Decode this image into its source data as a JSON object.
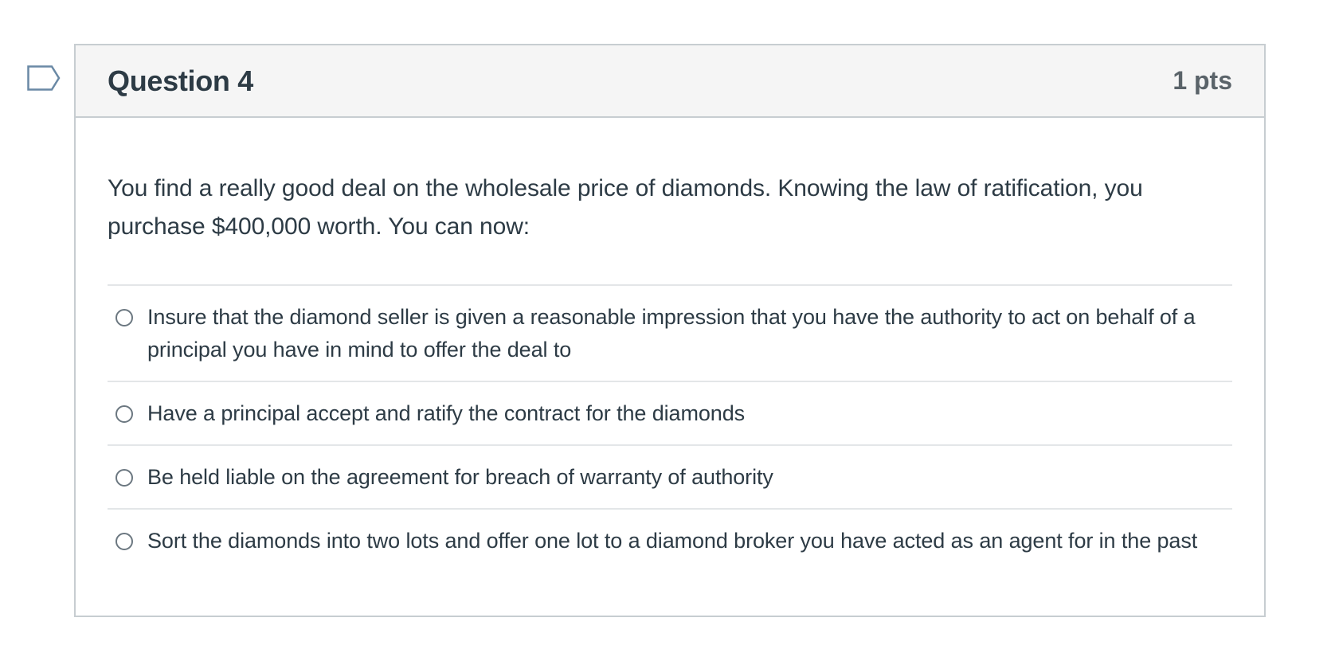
{
  "flag": {
    "icon": "bookmark-flag-icon",
    "color": "#6a89a5"
  },
  "question": {
    "title": "Question 4",
    "points": "1 pts",
    "text": "You find a really good deal on the wholesale price of diamonds. Knowing the law of ratification, you purchase $400,000 worth. You can now:",
    "answers": [
      {
        "label": "Insure that the diamond seller is given a reasonable impression that you have the authority to act on behalf of a principal you have in mind to offer the deal to",
        "selected": false
      },
      {
        "label": "Have a principal accept and ratify the contract for the diamonds",
        "selected": false
      },
      {
        "label": "Be held liable on the agreement for breach of warranty of authority",
        "selected": false
      },
      {
        "label": "Sort the diamonds into two lots and offer one lot to a diamond broker you have acted as an agent for in the past",
        "selected": false
      }
    ]
  },
  "colors": {
    "header_bg": "#f5f5f5",
    "border": "#c7cdd1",
    "divider": "#e3e6e8",
    "text": "#2d3b45",
    "points_text": "#5a6369"
  }
}
